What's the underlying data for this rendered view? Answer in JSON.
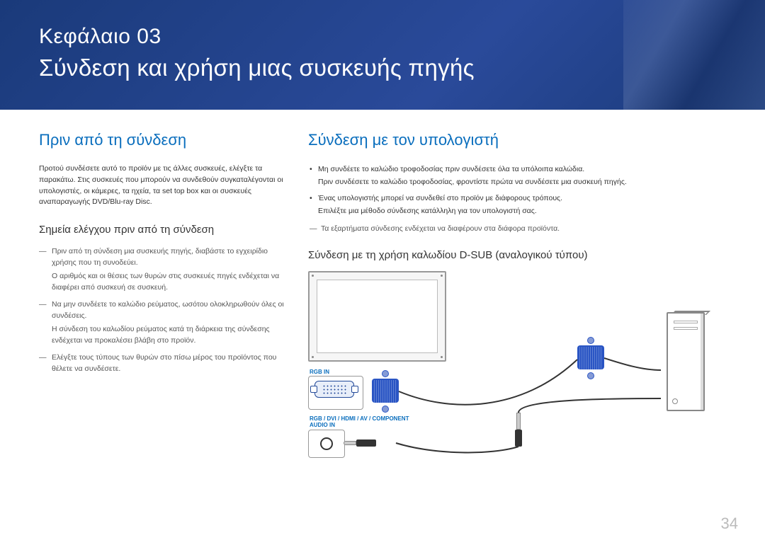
{
  "header": {
    "chapter_label": "Κεφάλαιο 03",
    "chapter_title": "Σύνδεση και χρήση μιας συσκευής πηγής"
  },
  "left": {
    "heading": "Πριν από τη σύνδεση",
    "intro": "Προτού συνδέσετε αυτό το προϊόν με τις άλλες συσκευές, ελέγξτε τα παρακάτω. Στις συσκευές που μπορούν να συνδεθούν συγκαταλέγονται οι υπολογιστές, οι κάμερες, τα ηχεία, τα set top box και οι συσκευές αναπαραγωγής DVD/Blu-ray Disc.",
    "sub_heading": "Σημεία ελέγχου πριν από τη σύνδεση",
    "notes": [
      {
        "main": "Πριν από τη σύνδεση μια συσκευής πηγής, διαβάστε το εγχειρίδιο χρήσης που τη συνοδεύει.",
        "sub": "Ο αριθμός και οι θέσεις των θυρών στις συσκευές πηγές ενδέχεται να διαφέρει από συσκευή σε συσκευή."
      },
      {
        "main": "Να μην συνδέετε το καλώδιο ρεύματος, ωσότου ολοκληρωθούν όλες οι συνδέσεις.",
        "sub": "Η σύνδεση του καλωδίου ρεύματος κατά τη διάρκεια της σύνδεσης ενδέχεται να προκαλέσει βλάβη στο προϊόν."
      },
      {
        "main": "Ελέγξτε τους τύπους των θυρών στο πίσω μέρος του προϊόντος που θέλετε να συνδέσετε.",
        "sub": ""
      }
    ]
  },
  "right": {
    "heading": "Σύνδεση με τον υπολογιστή",
    "bullets": [
      {
        "main": "Μη συνδέετε το καλώδιο τροφοδοσίας πριν συνδέσετε όλα τα υπόλοιπα καλώδια.",
        "sub": "Πριν συνδέσετε το καλώδιο τροφοδοσίας, φροντίστε πρώτα να συνδέσετε μια συσκευή πηγής."
      },
      {
        "main": "Ένας υπολογιστής μπορεί να συνδεθεί στο προϊόν με διάφορους τρόπους.",
        "sub": "Επιλέξτε μια μέθοδο σύνδεσης κατάλληλη για τον υπολογιστή σας."
      }
    ],
    "dash_note": "Τα εξαρτήματα σύνδεσης ενδέχεται να διαφέρουν στα διάφορα προϊόντα.",
    "sub_heading": "Σύνδεση με τη χρήση καλωδίου D-SUB (αναλογικού τύπου)",
    "labels": {
      "rgb_in": "RGB IN",
      "audio_in": "RGB / DVI / HDMI / AV / COMPONENT AUDIO IN"
    }
  },
  "page_number": "34"
}
